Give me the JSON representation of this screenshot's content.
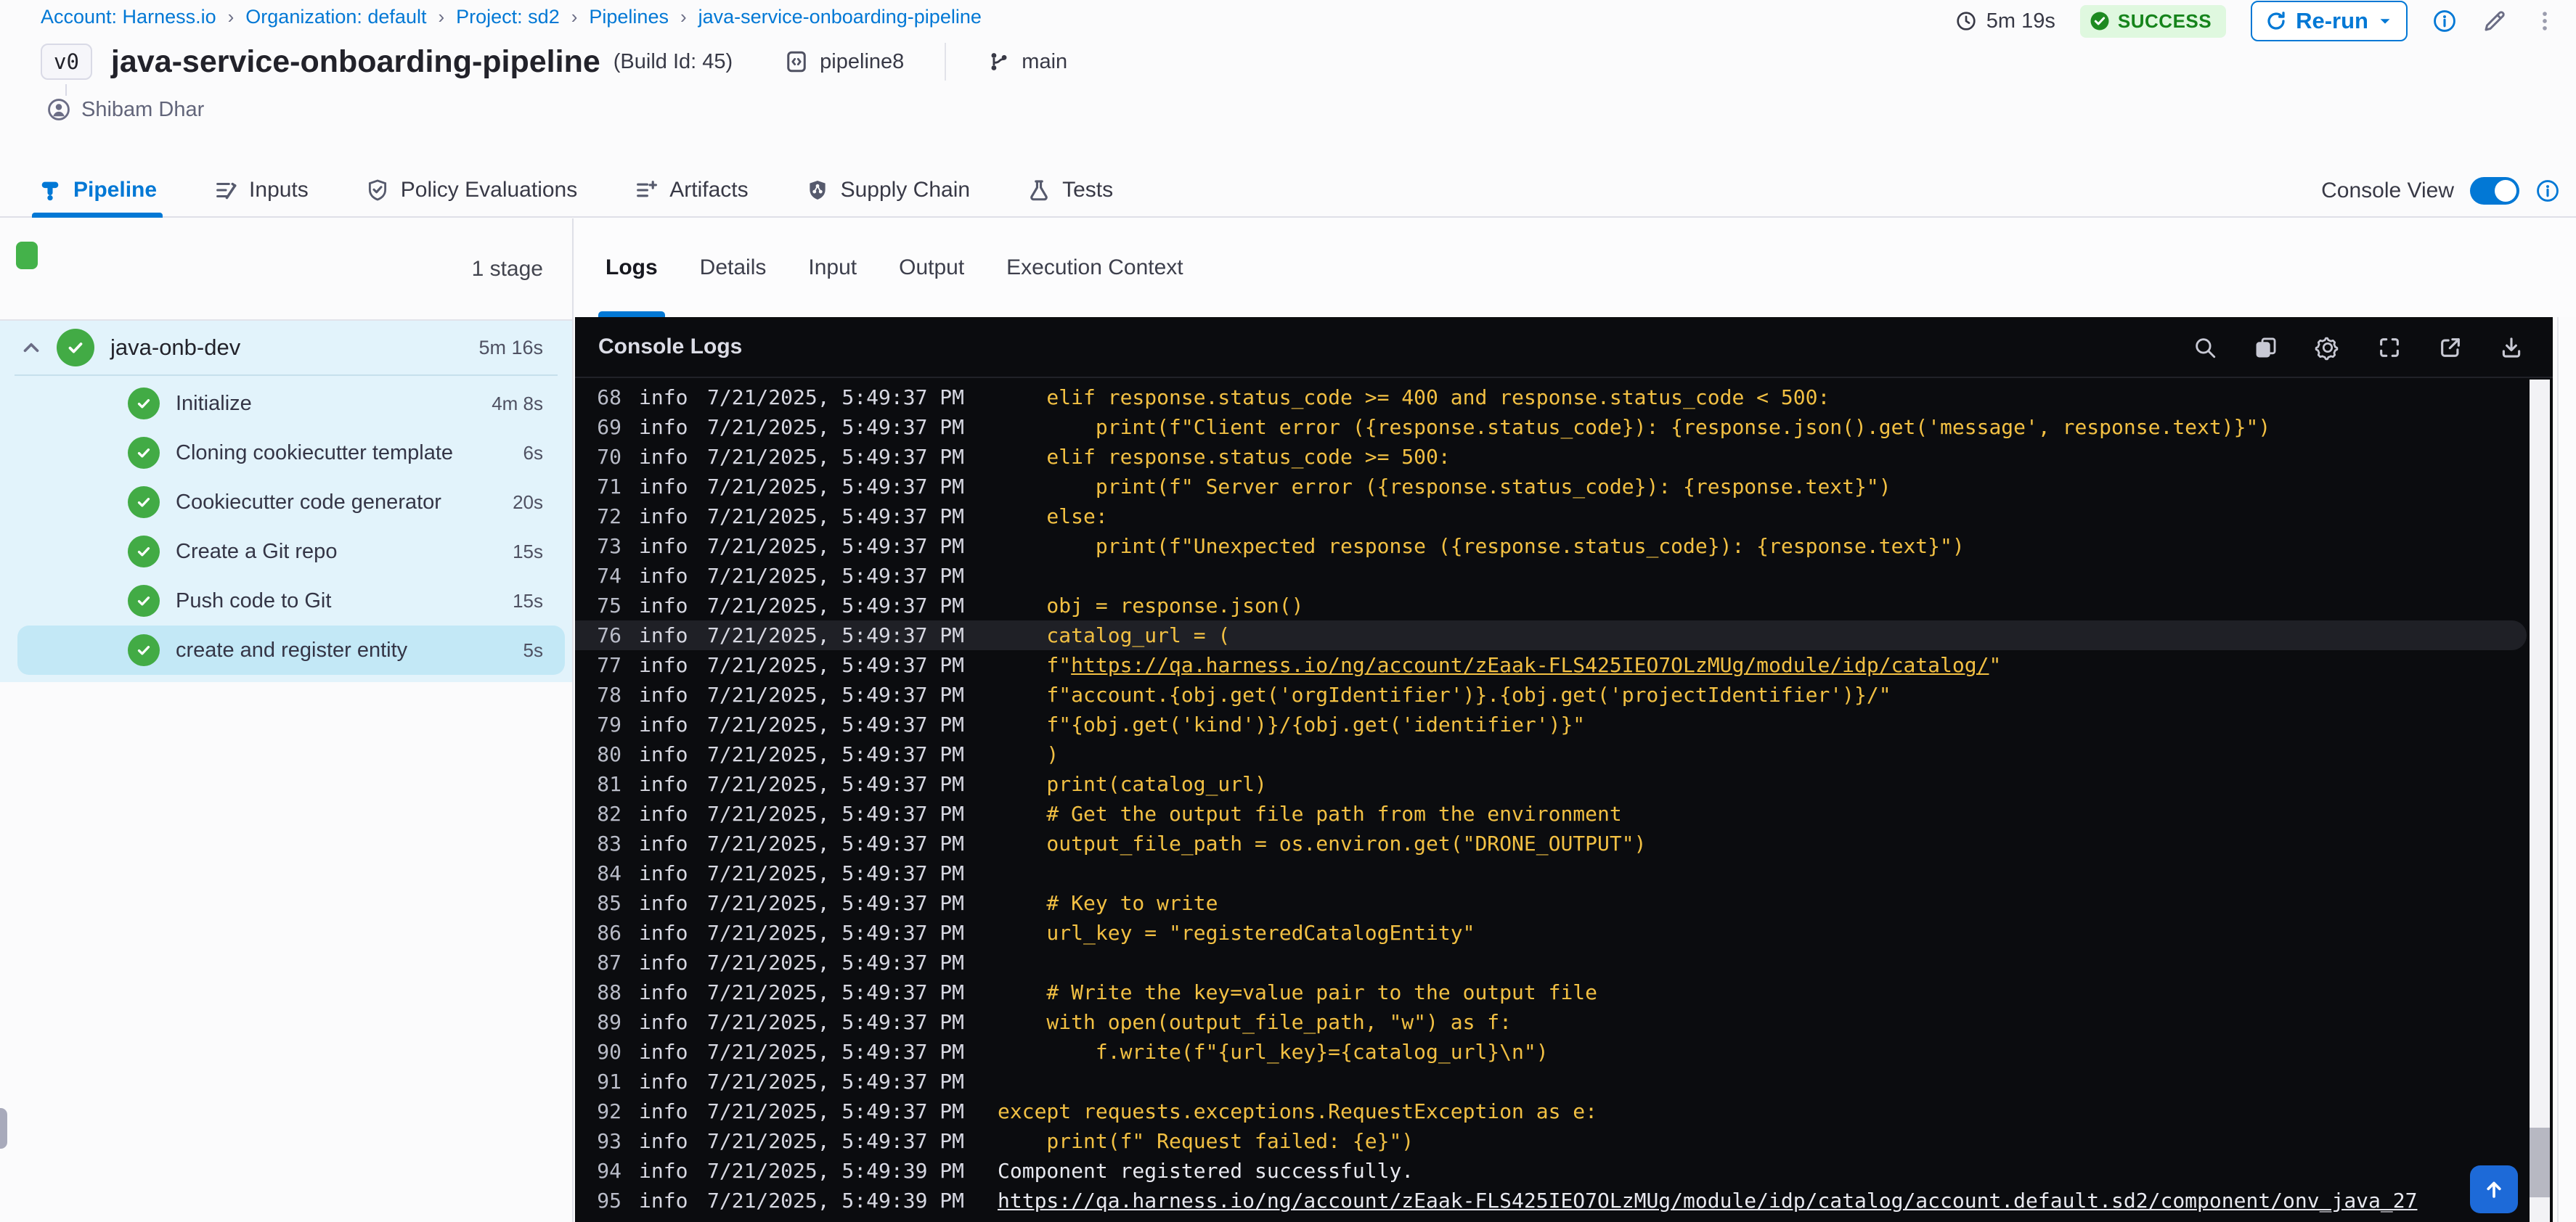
{
  "breadcrumb": {
    "separator": "›",
    "items": [
      "Account: Harness.io",
      "Organization: default",
      "Project: sd2",
      "Pipelines",
      "java-service-onboarding-pipeline"
    ]
  },
  "run_meta": {
    "duration": "5m 19s",
    "status": "SUCCESS",
    "rerun_label": "Re-run"
  },
  "header": {
    "version_badge": "v0",
    "title": "java-service-onboarding-pipeline",
    "build_id": "(Build Id: 45)",
    "pipeline_ref": "pipeline8",
    "branch": "main",
    "author": "Shibam Dhar"
  },
  "tabbar": {
    "items": [
      {
        "label": "Pipeline",
        "icon": "pipeline",
        "active": true
      },
      {
        "label": "Inputs",
        "icon": "inputs",
        "active": false
      },
      {
        "label": "Policy Evaluations",
        "icon": "policy",
        "active": false
      },
      {
        "label": "Artifacts",
        "icon": "artifacts",
        "active": false
      },
      {
        "label": "Supply Chain",
        "icon": "supply-chain",
        "active": false
      },
      {
        "label": "Tests",
        "icon": "tests",
        "active": false
      }
    ],
    "console_view_label": "Console View",
    "console_view_on": true
  },
  "stage_panel": {
    "stage_count_label": "1 stage",
    "stage": {
      "name": "java-onb-dev",
      "duration": "5m 16s"
    },
    "steps": [
      {
        "name": "Initialize",
        "duration": "4m 8s",
        "selected": false
      },
      {
        "name": "Cloning cookiecutter template",
        "duration": "6s",
        "selected": false
      },
      {
        "name": "Cookiecutter code generator",
        "duration": "20s",
        "selected": false
      },
      {
        "name": "Create a Git repo",
        "duration": "15s",
        "selected": false
      },
      {
        "name": "Push code to Git",
        "duration": "15s",
        "selected": false
      },
      {
        "name": "create and register entity",
        "duration": "5s",
        "selected": true
      }
    ]
  },
  "log_panel": {
    "title": "Console Logs",
    "tabs": [
      {
        "label": "Logs",
        "active": true
      },
      {
        "label": "Details",
        "active": false
      },
      {
        "label": "Input",
        "active": false
      },
      {
        "label": "Output",
        "active": false
      },
      {
        "label": "Execution Context",
        "active": false
      }
    ],
    "toolbar_icons": [
      "search",
      "copy",
      "settings",
      "fullscreen",
      "open-in-new",
      "download"
    ],
    "lines": [
      {
        "n": 68,
        "level": "info",
        "ts": "7/21/2025, 5:49:37 PM",
        "text": "    elif response.status_code >= 400 and response.status_code < 500:"
      },
      {
        "n": 69,
        "level": "info",
        "ts": "7/21/2025, 5:49:37 PM",
        "text": "        print(f\"Client error ({response.status_code}): {response.json().get('message', response.text)}\")"
      },
      {
        "n": 70,
        "level": "info",
        "ts": "7/21/2025, 5:49:37 PM",
        "text": "    elif response.status_code >= 500:"
      },
      {
        "n": 71,
        "level": "info",
        "ts": "7/21/2025, 5:49:37 PM",
        "text": "        print(f\" Server error ({response.status_code}): {response.text}\")"
      },
      {
        "n": 72,
        "level": "info",
        "ts": "7/21/2025, 5:49:37 PM",
        "text": "    else:"
      },
      {
        "n": 73,
        "level": "info",
        "ts": "7/21/2025, 5:49:37 PM",
        "text": "        print(f\"Unexpected response ({response.status_code}): {response.text}\")"
      },
      {
        "n": 74,
        "level": "info",
        "ts": "7/21/2025, 5:49:37 PM",
        "text": ""
      },
      {
        "n": 75,
        "level": "info",
        "ts": "7/21/2025, 5:49:37 PM",
        "text": "    obj = response.json()"
      },
      {
        "n": 76,
        "level": "info",
        "ts": "7/21/2025, 5:49:37 PM",
        "text": "    catalog_url = (",
        "highlight": true
      },
      {
        "n": 77,
        "level": "info",
        "ts": "7/21/2025, 5:49:37 PM",
        "pre": "    f\"",
        "link": "https://qa.harness.io/ng/account/zEaak-FLS425IEO7OLzMUg/module/idp/catalog/",
        "post": "\""
      },
      {
        "n": 78,
        "level": "info",
        "ts": "7/21/2025, 5:49:37 PM",
        "text": "    f\"account.{obj.get('orgIdentifier')}.{obj.get('projectIdentifier')}/\""
      },
      {
        "n": 79,
        "level": "info",
        "ts": "7/21/2025, 5:49:37 PM",
        "text": "    f\"{obj.get('kind')}/{obj.get('identifier')}\""
      },
      {
        "n": 80,
        "level": "info",
        "ts": "7/21/2025, 5:49:37 PM",
        "text": "    )"
      },
      {
        "n": 81,
        "level": "info",
        "ts": "7/21/2025, 5:49:37 PM",
        "text": "    print(catalog_url)"
      },
      {
        "n": 82,
        "level": "info",
        "ts": "7/21/2025, 5:49:37 PM",
        "text": "    # Get the output file path from the environment"
      },
      {
        "n": 83,
        "level": "info",
        "ts": "7/21/2025, 5:49:37 PM",
        "text": "    output_file_path = os.environ.get(\"DRONE_OUTPUT\")"
      },
      {
        "n": 84,
        "level": "info",
        "ts": "7/21/2025, 5:49:37 PM",
        "text": ""
      },
      {
        "n": 85,
        "level": "info",
        "ts": "7/21/2025, 5:49:37 PM",
        "text": "    # Key to write"
      },
      {
        "n": 86,
        "level": "info",
        "ts": "7/21/2025, 5:49:37 PM",
        "text": "    url_key = \"registeredCatalogEntity\""
      },
      {
        "n": 87,
        "level": "info",
        "ts": "7/21/2025, 5:49:37 PM",
        "text": ""
      },
      {
        "n": 88,
        "level": "info",
        "ts": "7/21/2025, 5:49:37 PM",
        "text": "    # Write the key=value pair to the output file"
      },
      {
        "n": 89,
        "level": "info",
        "ts": "7/21/2025, 5:49:37 PM",
        "text": "    with open(output_file_path, \"w\") as f:"
      },
      {
        "n": 90,
        "level": "info",
        "ts": "7/21/2025, 5:49:37 PM",
        "text": "        f.write(f\"{url_key}={catalog_url}\\n\")"
      },
      {
        "n": 91,
        "level": "info",
        "ts": "7/21/2025, 5:49:37 PM",
        "text": ""
      },
      {
        "n": 92,
        "level": "info",
        "ts": "7/21/2025, 5:49:37 PM",
        "text": "except requests.exceptions.RequestException as e:"
      },
      {
        "n": 93,
        "level": "info",
        "ts": "7/21/2025, 5:49:37 PM",
        "text": "    print(f\" Request failed: {e}\")"
      },
      {
        "n": 94,
        "level": "info",
        "ts": "7/21/2025, 5:49:39 PM",
        "text": "Component registered successfully.",
        "color": "white"
      },
      {
        "n": 95,
        "level": "info",
        "ts": "7/21/2025, 5:49:39 PM",
        "pre": "",
        "link": "https://qa.harness.io/ng/account/zEaak-FLS425IEO7OLzMUg/module/idp/catalog/account.default.sd2/component/onv_java_27",
        "post": "",
        "color": "white"
      }
    ]
  },
  "colors": {
    "accent_blue": "#0278d5",
    "success_green": "#42ab45",
    "status_badge_bg": "#dff8df",
    "status_badge_text": "#15841b",
    "stage_panel_blue": "#e2f3fb",
    "stage_selected_blue": "#c3e8f6",
    "console_bg": "#0b0c0f",
    "log_code_yellow": "#f2c043",
    "log_text_white": "#e8e9f0"
  }
}
